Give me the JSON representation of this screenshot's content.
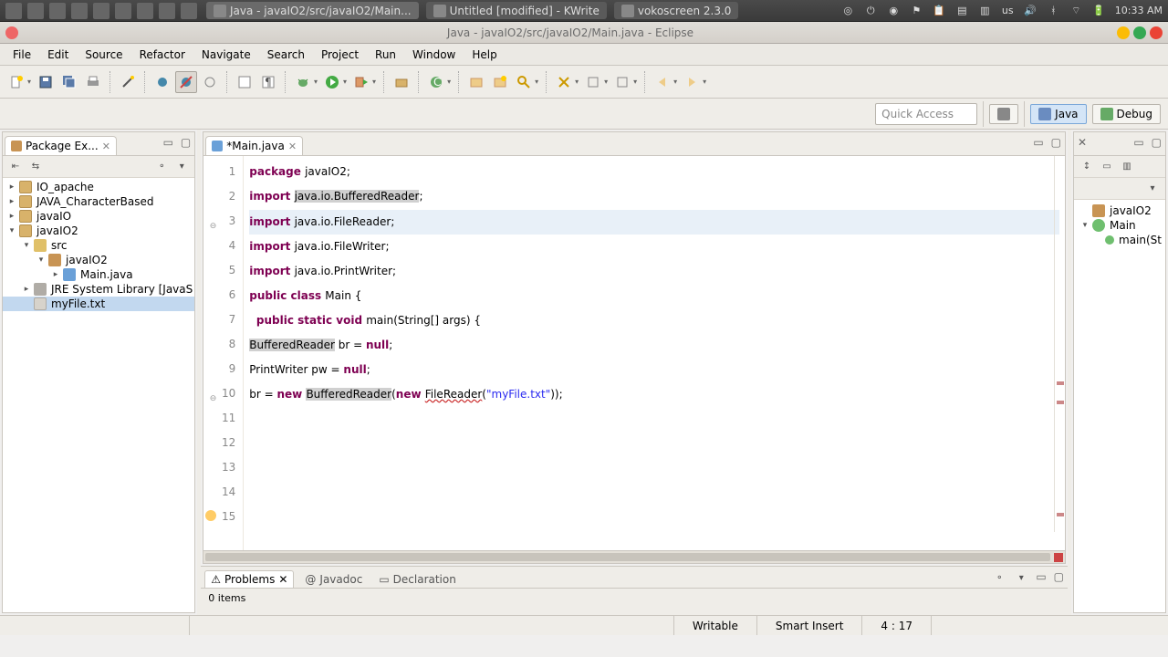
{
  "os": {
    "tasks": [
      {
        "icon": "eclipse",
        "label": "Java - javaIO2/src/javaIO2/Main...",
        "active": true
      },
      {
        "icon": "kwrite",
        "label": "Untitled [modified] - KWrite"
      },
      {
        "icon": "voko",
        "label": "vokoscreen 2.3.0"
      }
    ],
    "tray_lang": "us",
    "clock": "10:33 AM"
  },
  "window": {
    "title": "Java - javaIO2/src/javaIO2/Main.java - Eclipse"
  },
  "menu": [
    "File",
    "Edit",
    "Source",
    "Refactor",
    "Navigate",
    "Search",
    "Project",
    "Run",
    "Window",
    "Help"
  ],
  "quick_access_placeholder": "Quick Access",
  "perspectives": [
    {
      "name": "Java",
      "active": true
    },
    {
      "name": "Debug",
      "active": false
    }
  ],
  "package_explorer": {
    "title": "Package Ex...",
    "tree": [
      {
        "d": 0,
        "tw": "▸",
        "ic": "ic-prj",
        "label": "IO_apache"
      },
      {
        "d": 0,
        "tw": "▸",
        "ic": "ic-prj",
        "label": "JAVA_CharacterBased"
      },
      {
        "d": 0,
        "tw": "▸",
        "ic": "ic-prj",
        "label": "javaIO"
      },
      {
        "d": 0,
        "tw": "▾",
        "ic": "ic-prj",
        "label": "javaIO2"
      },
      {
        "d": 1,
        "tw": "▾",
        "ic": "ic-folder",
        "label": "src"
      },
      {
        "d": 2,
        "tw": "▾",
        "ic": "ic-pkg",
        "label": "javaIO2"
      },
      {
        "d": 3,
        "tw": "▸",
        "ic": "ic-java",
        "label": "Main.java"
      },
      {
        "d": 1,
        "tw": "▸",
        "ic": "ic-lib",
        "label": "JRE System Library [JavaS"
      },
      {
        "d": 1,
        "tw": "",
        "ic": "ic-file",
        "label": "myFile.txt",
        "sel": true
      }
    ]
  },
  "editor": {
    "tab_label": "*Main.java",
    "lines": [
      {
        "n": 1,
        "seg": [
          {
            "t": "package ",
            "c": "kw"
          },
          {
            "t": "javaIO2;"
          }
        ]
      },
      {
        "n": 2,
        "seg": [
          {
            "t": ""
          }
        ]
      },
      {
        "n": 3,
        "ann": "fold",
        "seg": [
          {
            "t": "import ",
            "c": "kw"
          },
          {
            "t": "java.io.BufferedReader",
            "c": "hl"
          },
          {
            "t": ";"
          }
        ]
      },
      {
        "n": 4,
        "cur": true,
        "seg": [
          {
            "t": "import ",
            "c": "kw"
          },
          {
            "t": "java.io.FileReader;"
          }
        ]
      },
      {
        "n": 5,
        "seg": [
          {
            "t": "import ",
            "c": "kw"
          },
          {
            "t": "java.io.FileWriter;"
          }
        ]
      },
      {
        "n": 6,
        "seg": [
          {
            "t": "import ",
            "c": "kw"
          },
          {
            "t": "java.io.PrintWriter;"
          }
        ]
      },
      {
        "n": 7,
        "seg": [
          {
            "t": ""
          }
        ]
      },
      {
        "n": 8,
        "seg": [
          {
            "t": "public class ",
            "c": "kw"
          },
          {
            "t": "Main {"
          }
        ]
      },
      {
        "n": 9,
        "seg": [
          {
            "t": ""
          }
        ]
      },
      {
        "n": 10,
        "ann": "fold",
        "seg": [
          {
            "t": "  "
          },
          {
            "t": "public static void ",
            "c": "kw"
          },
          {
            "t": "main(String[] args) {"
          }
        ]
      },
      {
        "n": 11,
        "seg": [
          {
            "t": ""
          }
        ]
      },
      {
        "n": 12,
        "seg": [
          {
            "t": "BufferedReader",
            "c": "hl"
          },
          {
            "t": " br = "
          },
          {
            "t": "null",
            "c": "kw"
          },
          {
            "t": ";"
          }
        ]
      },
      {
        "n": 13,
        "seg": [
          {
            "t": "PrintWriter pw = "
          },
          {
            "t": "null",
            "c": "kw"
          },
          {
            "t": ";"
          }
        ]
      },
      {
        "n": 14,
        "seg": [
          {
            "t": ""
          }
        ]
      },
      {
        "n": 15,
        "ann": "warn",
        "seg": [
          {
            "t": "br = "
          },
          {
            "t": "new ",
            "c": "kw"
          },
          {
            "t": "BufferedReader",
            "c": "hl"
          },
          {
            "t": "("
          },
          {
            "t": "new ",
            "c": "kw"
          },
          {
            "t": "FileReader",
            "sq": true
          },
          {
            "t": "("
          },
          {
            "t": "\"myFile.txt\"",
            "c": "str"
          },
          {
            "t": "));"
          }
        ]
      }
    ]
  },
  "outline": {
    "items": [
      {
        "d": 0,
        "tw": "",
        "ic": "ic-pkg",
        "label": "javaIO2"
      },
      {
        "d": 0,
        "tw": "▾",
        "ic": "ic-class",
        "label": "Main"
      },
      {
        "d": 1,
        "tw": "",
        "ic": "ic-method",
        "label": "main(St"
      }
    ]
  },
  "bottom": {
    "tabs": [
      "Problems",
      "Javadoc",
      "Declaration"
    ],
    "active": 0,
    "body": "0 items"
  },
  "status": {
    "writable": "Writable",
    "insert": "Smart Insert",
    "pos": "4 : 17"
  }
}
